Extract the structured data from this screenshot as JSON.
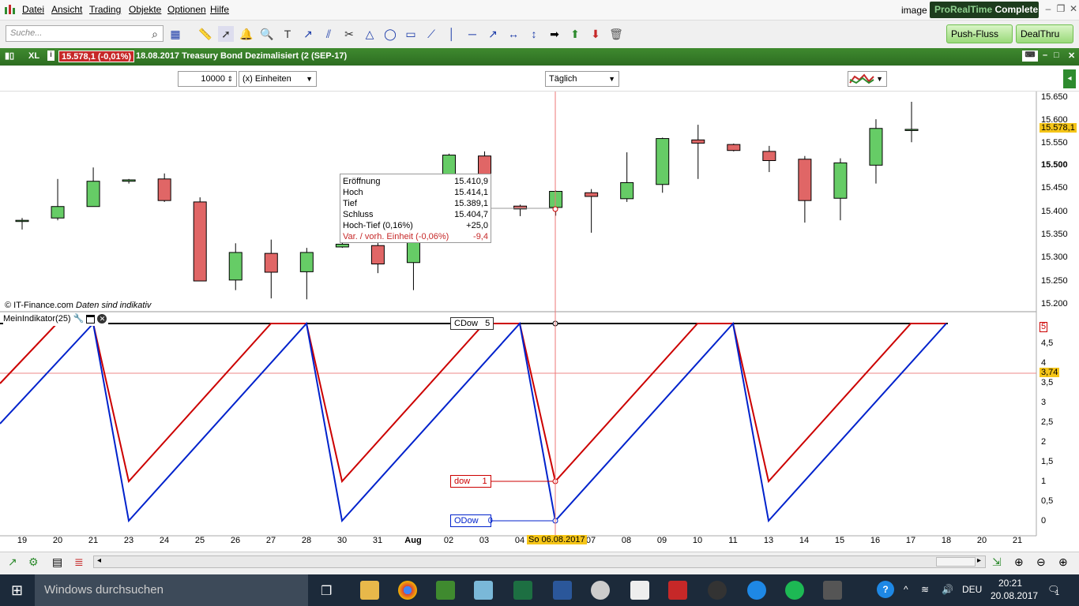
{
  "menu": {
    "items": [
      "Datei",
      "Ansicht",
      "Trading",
      "Objekte",
      "Optionen",
      "Hilfe"
    ],
    "image_label": "image",
    "brand": "ProRealTime",
    "brand_edition": "Complete"
  },
  "toolbar": {
    "search_placeholder": "Suche...",
    "push_label": "Push-Fluss",
    "deal_label": "DealThru"
  },
  "chart_header": {
    "symbol_size": "XL",
    "price": "15.578,1 (-0,01%)",
    "title": "18.08.2017 Treasury Bond Dezimalisiert (2  (SEP-17)"
  },
  "subbar": {
    "quantity": "10000",
    "unit": "(x) Einheiten",
    "period": "Täglich"
  },
  "tooltip": {
    "rows": [
      {
        "label": "Eröffnung",
        "value": "15.410,9"
      },
      {
        "label": "Hoch",
        "value": "15.414,1"
      },
      {
        "label": "Tief",
        "value": "15.389,1"
      },
      {
        "label": "Schluss",
        "value": "15.404,7"
      },
      {
        "label": "Hoch-Tief (0,16%)",
        "value": "+25,0"
      },
      {
        "label": "Var. / vorh. Einheit (-0,06%)",
        "value": "-9,4"
      }
    ]
  },
  "copyright": "© IT-Finance.com",
  "copyright_note": "Daten sind indikativ",
  "indicator": {
    "name": "MeinIndikator(25)"
  },
  "tags": {
    "cdow": "CDow",
    "cdow_val": "5",
    "dow": "dow",
    "dow_val": "1",
    "odow": "ODow",
    "odow_val": "0",
    "ind_value": "3,74",
    "ind_top": "5"
  },
  "price_axis": [
    "15.650",
    "15.600",
    "15.550",
    "15.500",
    "15.450",
    "15.400",
    "15.350",
    "15.300",
    "15.250",
    "15.200"
  ],
  "last_price": "15.578,1",
  "ind_axis": [
    "4,5",
    "4",
    "3,5",
    "3",
    "2,5",
    "2",
    "1,5",
    "1",
    "0,5",
    "0"
  ],
  "x_labels": [
    "19",
    "20",
    "21",
    "23",
    "24",
    "25",
    "26",
    "27",
    "28",
    "30",
    "31",
    "Aug",
    "02",
    "03",
    "04",
    "07",
    "08",
    "09",
    "10",
    "11",
    "13",
    "14",
    "15",
    "16",
    "17",
    "18",
    "20",
    "21"
  ],
  "crosshair_date": "So 06.08.2017",
  "taskbar": {
    "search": "Windows durchsuchen",
    "lang": "DEU",
    "time": "20:21",
    "date": "20.08.2017",
    "notif": "1"
  },
  "colors": {
    "up": "#66cc66",
    "down": "#e06666",
    "dow": "#cc0000",
    "odow": "#0022cc",
    "header": "#3f8a2f"
  },
  "chart_data": {
    "type": "candlestick",
    "ylim": [
      15190,
      15665
    ],
    "candles": [
      {
        "date": "19",
        "o": 15380,
        "h": 15385,
        "l": 15360,
        "c": 15380
      },
      {
        "date": "20",
        "o": 15385,
        "h": 15470,
        "l": 15380,
        "c": 15410
      },
      {
        "date": "21",
        "o": 15410,
        "h": 15495,
        "l": 15410,
        "c": 15465
      },
      {
        "date": "23",
        "o": 15465,
        "h": 15470,
        "l": 15460,
        "c": 15468
      },
      {
        "date": "24",
        "o": 15470,
        "h": 15482,
        "l": 15420,
        "c": 15423
      },
      {
        "date": "25",
        "o": 15420,
        "h": 15430,
        "l": 15248,
        "c": 15248
      },
      {
        "date": "26",
        "o": 15250,
        "h": 15330,
        "l": 15228,
        "c": 15310
      },
      {
        "date": "27",
        "o": 15308,
        "h": 15338,
        "l": 15210,
        "c": 15267
      },
      {
        "date": "28",
        "o": 15268,
        "h": 15320,
        "l": 15208,
        "c": 15310
      },
      {
        "date": "30",
        "o": 15322,
        "h": 15360,
        "l": 15320,
        "c": 15328
      },
      {
        "date": "31",
        "o": 15325,
        "h": 15338,
        "l": 15265,
        "c": 15285
      },
      {
        "date": "Aug",
        "o": 15288,
        "h": 15395,
        "l": 15228,
        "c": 15390
      },
      {
        "date": "02",
        "o": 15390,
        "h": 15525,
        "l": 15370,
        "c": 15522
      },
      {
        "date": "04",
        "o": 15520,
        "h": 15530,
        "l": 15368,
        "c": 15412
      },
      {
        "date": "06",
        "o": 15410.9,
        "h": 15414.1,
        "l": 15389.1,
        "c": 15404.7
      },
      {
        "date": "07",
        "o": 15408,
        "h": 15445,
        "l": 15390,
        "c": 15443
      },
      {
        "date": "08",
        "o": 15440,
        "h": 15448,
        "l": 15353,
        "c": 15432
      },
      {
        "date": "09",
        "o": 15427,
        "h": 15528,
        "l": 15420,
        "c": 15462
      },
      {
        "date": "10",
        "o": 15458,
        "h": 15560,
        "l": 15440,
        "c": 15558
      },
      {
        "date": "11",
        "o": 15555,
        "h": 15588,
        "l": 15470,
        "c": 15548
      },
      {
        "date": "13",
        "o": 15545,
        "h": 15547,
        "l": 15530,
        "c": 15532
      },
      {
        "date": "14",
        "o": 15530,
        "h": 15542,
        "l": 15485,
        "c": 15510
      },
      {
        "date": "15",
        "o": 15513,
        "h": 15520,
        "l": 15375,
        "c": 15423
      },
      {
        "date": "16",
        "o": 15428,
        "h": 15515,
        "l": 15380,
        "c": 15505
      },
      {
        "date": "17",
        "o": 15500,
        "h": 15600,
        "l": 15460,
        "c": 15580
      },
      {
        "date": "18",
        "o": 15578,
        "h": 15638,
        "l": 15550,
        "c": 15578
      }
    ],
    "indicator": {
      "ylim": [
        -0.1,
        5.1
      ],
      "series": [
        {
          "name": "dow",
          "points": [
            [
              -0.2,
              3.5
            ],
            [
              1,
              5
            ],
            [
              2,
              1
            ],
            [
              4,
              5
            ],
            [
              5,
              1
            ],
            [
              7,
              5
            ],
            [
              8,
              1
            ],
            [
              10,
              5
            ],
            [
              11,
              1
            ],
            [
              13,
              5
            ],
            [
              14,
              5
            ]
          ]
        },
        {
          "name": "ODow",
          "points": [
            [
              -0.2,
              2.5
            ],
            [
              1,
              5
            ],
            [
              2,
              0
            ],
            [
              5,
              0
            ],
            [
              6.97,
              5
            ],
            [
              8,
              0
            ],
            [
              10,
              5
            ],
            [
              11,
              0
            ],
            [
              14,
              5
            ]
          ]
        }
      ]
    }
  }
}
